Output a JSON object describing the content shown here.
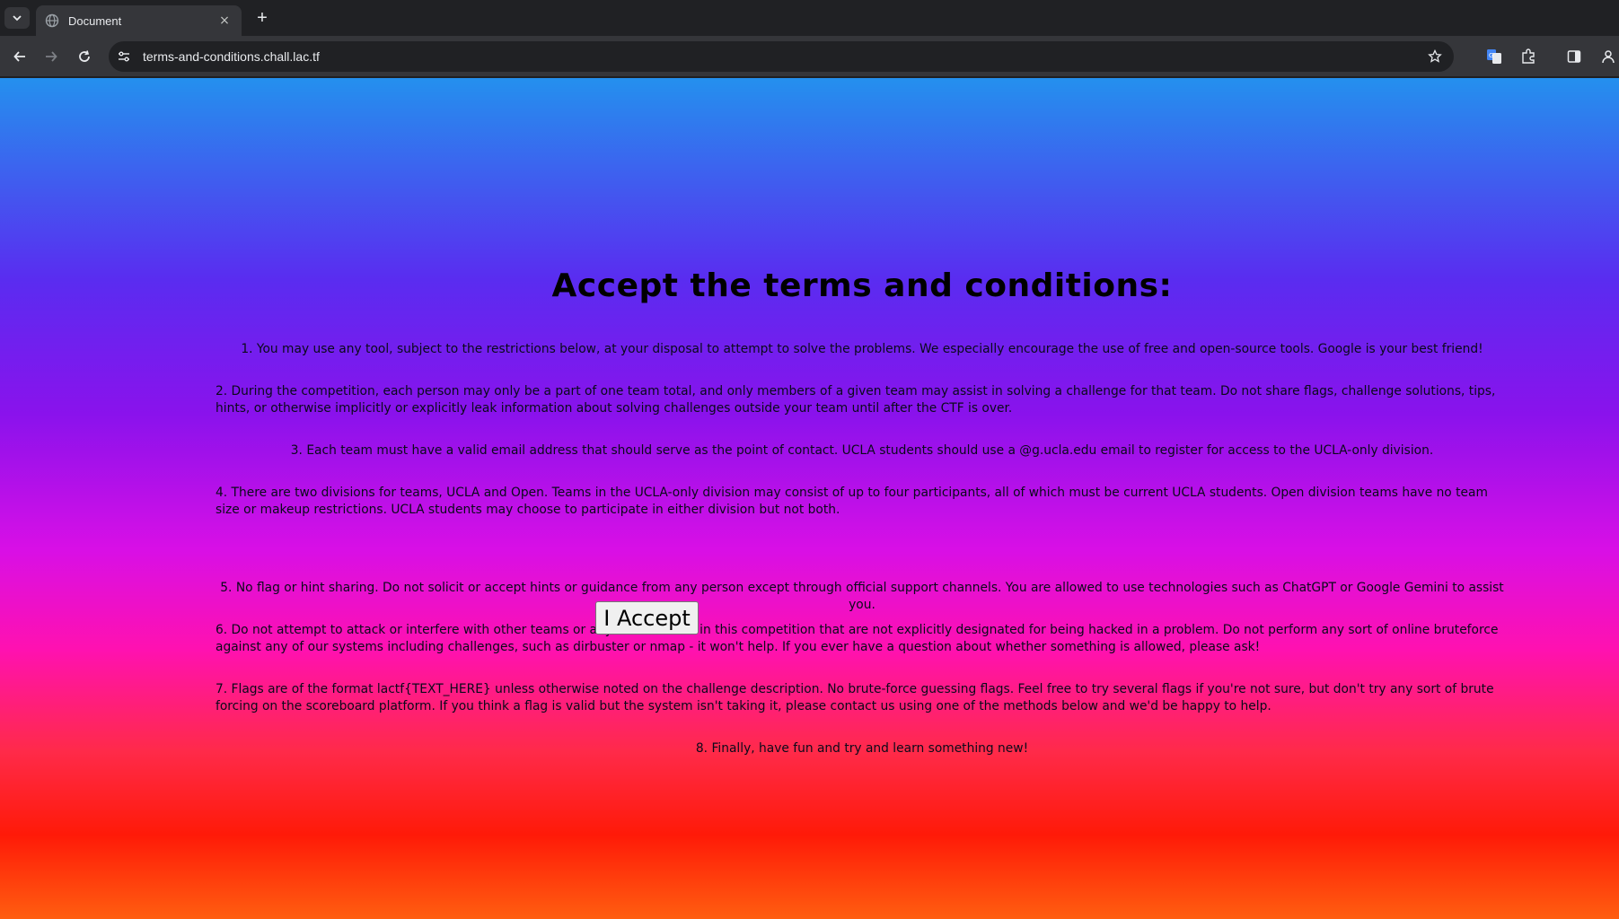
{
  "browser": {
    "tab": {
      "title": "Document"
    },
    "new_tab_symbol": "+",
    "close_symbol": "×",
    "address_bar": {
      "url": "terms-and-conditions.chall.lac.tf"
    },
    "icons": [
      "tab-search-icon",
      "globe-icon",
      "close-icon",
      "plus-icon",
      "back-arrow-icon",
      "forward-arrow-icon",
      "reload-icon",
      "site-info-icon",
      "star-icon",
      "translate-icon",
      "extensions-icon",
      "side-panel-icon",
      "profile-icon"
    ]
  },
  "page": {
    "title": "Accept the terms and conditions:",
    "terms": [
      "1. You may use any tool, subject to the restrictions below, at your disposal to attempt to solve the problems. We especially encourage the use of free and open-source tools. Google is your best friend!",
      "2. During the competition, each person may only be a part of one team total, and only members of a given team may assist in solving a challenge for that team. Do not share flags, challenge solutions, tips, hints, or otherwise implicitly or explicitly leak information about solving challenges outside your team until after the CTF is over.",
      "3. Each team must have a valid email address that should serve as the point of contact. UCLA students should use a @g.ucla.edu email to register for access to the UCLA-only division.",
      "4. There are two divisions for teams, UCLA and Open. Teams in the UCLA-only division may consist of up to four participants, all of which must be current UCLA students. Open division teams have no team size or makeup restrictions. UCLA students may choose to participate in either division but not both.",
      "5. No flag or hint sharing. Do not solicit or accept hints or guidance from any person except through official support channels. You are allowed to use technologies such as ChatGPT or Google Gemini to assist you.",
      "6. Do not attempt to attack or interfere with other teams or any servers used in this competition that are not explicitly designated for being hacked in a problem. Do not perform any sort of online bruteforce against any of our systems including challenges, such as dirbuster or nmap - it won't help. If you ever have a question about whether something is allowed, please ask!",
      "7. Flags are of the format lactf{TEXT_HERE} unless otherwise noted on the challenge description. No brute-force guessing flags. Feel free to try several flags if you're not sure, but don't try any sort of brute forcing on the scoreboard platform. If you think a flag is valid but the system isn't taking it, please contact us using one of the methods below and we'd be happy to help.",
      "8. Finally, have fun and try and learn something new!"
    ],
    "accept_button": "I Accept"
  },
  "colors": {
    "gradient_top": "#2490ee",
    "gradient_mid": "#d80fe6",
    "gradient_bottom": "#ff5e10"
  }
}
